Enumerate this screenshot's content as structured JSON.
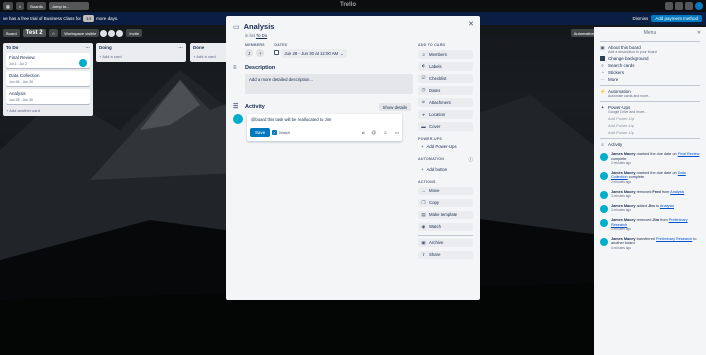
{
  "topbar": {
    "boards_label": "Boards",
    "search_placeholder": "Jump to...",
    "logo": "Trello"
  },
  "banner": {
    "text": "ve has a free trial of Business Class for",
    "days": "14",
    "days_suffix": "more days.",
    "dismiss": "Dismiss",
    "add_payment": "Add payment method"
  },
  "board": {
    "view": "Board",
    "title": "Test 2",
    "workspace": "Workspace visible",
    "invite": "Invite",
    "automation": "Automation"
  },
  "lists": [
    {
      "title": "To Do",
      "cards": [
        {
          "title": "Final Review",
          "meta": "Jul 1 - Jul 2"
        },
        {
          "title": "Data Collection",
          "meta": "Jun 26 - Jun 30"
        },
        {
          "title": "Analysis",
          "meta": "Jun 28 - Jun 30"
        }
      ],
      "add": "+ Add another card"
    },
    {
      "title": "Doing",
      "add": "+ Add a card"
    },
    {
      "title": "Done",
      "add": "+ Add a card"
    }
  ],
  "modal": {
    "title": "Analysis",
    "in_list_prefix": "in list",
    "in_list": "To Do",
    "members_label": "MEMBERS",
    "dates_label": "DATES",
    "dates_value": "Jun 28 - Jun 30 at 12:00 AM",
    "description_title": "Description",
    "description_placeholder": "Add a more detailed description...",
    "activity_title": "Activity",
    "show_details": "Show details",
    "comment_text": "@board this task will be reallocated to Jim",
    "save": "Save",
    "watch": "Watch",
    "add_to_card_label": "ADD TO CARD",
    "add_to_card": [
      "Members",
      "Labels",
      "Checklist",
      "Dates",
      "Attachment",
      "Location",
      "Cover"
    ],
    "power_ups_label": "POWER-UPS",
    "add_power_ups": "Add Power-Ups",
    "automation_label": "AUTOMATION",
    "add_button": "Add button",
    "actions_label": "ACTIONS",
    "actions": [
      "Move",
      "Copy",
      "Make template",
      "Watch",
      "Archive",
      "Share"
    ]
  },
  "menu": {
    "title": "Menu",
    "items": [
      {
        "label": "About this board",
        "sub": "Add a description to your board"
      },
      {
        "label": "Change background"
      },
      {
        "label": "Search cards"
      },
      {
        "label": "Stickers"
      },
      {
        "label": "More"
      }
    ],
    "automation": {
      "label": "Automation",
      "sub": "Automate cards and more..."
    },
    "power_ups": {
      "label": "Power-Ups",
      "sub": "Google Drive and more..."
    },
    "power_up_slots": [
      "Add Power-Up",
      "Add Power-Up",
      "Add Power-Up"
    ],
    "activity_title": "Activity",
    "activities": [
      {
        "user": "James Macey",
        "pre": "marked the due date on",
        "link": "Final Review",
        "post": "complete",
        "when": "2 minutes ago"
      },
      {
        "user": "James Macey",
        "pre": "marked the due date on",
        "link": "Data Collection",
        "post": "complete",
        "when": "2 minutes ago"
      },
      {
        "user": "James Macey",
        "pre": "removed",
        "bold": "Fred",
        "mid": "from",
        "link": "Analysis",
        "when": "3 minutes ago"
      },
      {
        "user": "James Macey",
        "pre": "added",
        "bold": "Jim",
        "mid": "to",
        "link": "Analysis",
        "when": "3 minutes ago"
      },
      {
        "user": "James Macey",
        "pre": "removed",
        "bold": "Jim",
        "mid": "from",
        "link": "Preliminary Research",
        "when": "4 minutes ago"
      },
      {
        "user": "James Macey",
        "pre": "transferred",
        "link": "Preliminary Research",
        "post": "to another board",
        "when": "4 minutes ago"
      }
    ]
  }
}
